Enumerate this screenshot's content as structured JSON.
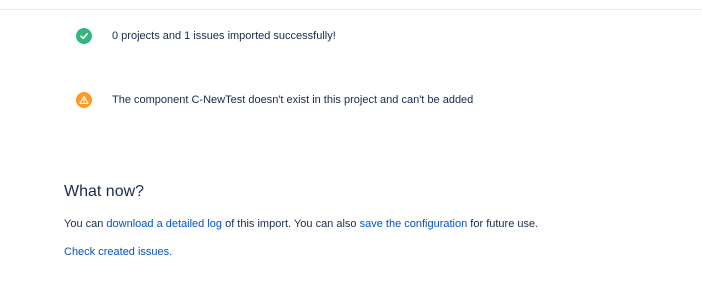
{
  "messages": {
    "success": {
      "text": "0 projects and 1 issues imported successfully!",
      "icon": "check-circle-icon",
      "color": "#36b37e"
    },
    "warning": {
      "text": "The component C-NewTest doesn't exist in this project and can't be added",
      "icon": "warning-icon",
      "color": "#ff991f"
    }
  },
  "what_now": {
    "heading": "What now?",
    "line1": {
      "prefix": "You can ",
      "link1": "download a detailed log",
      "middle": " of this import. You can also ",
      "link2": "save the configuration",
      "suffix": " for future use."
    },
    "check_link": "Check created issues."
  },
  "colors": {
    "link": "#0052cc",
    "text": "#172b4d"
  }
}
